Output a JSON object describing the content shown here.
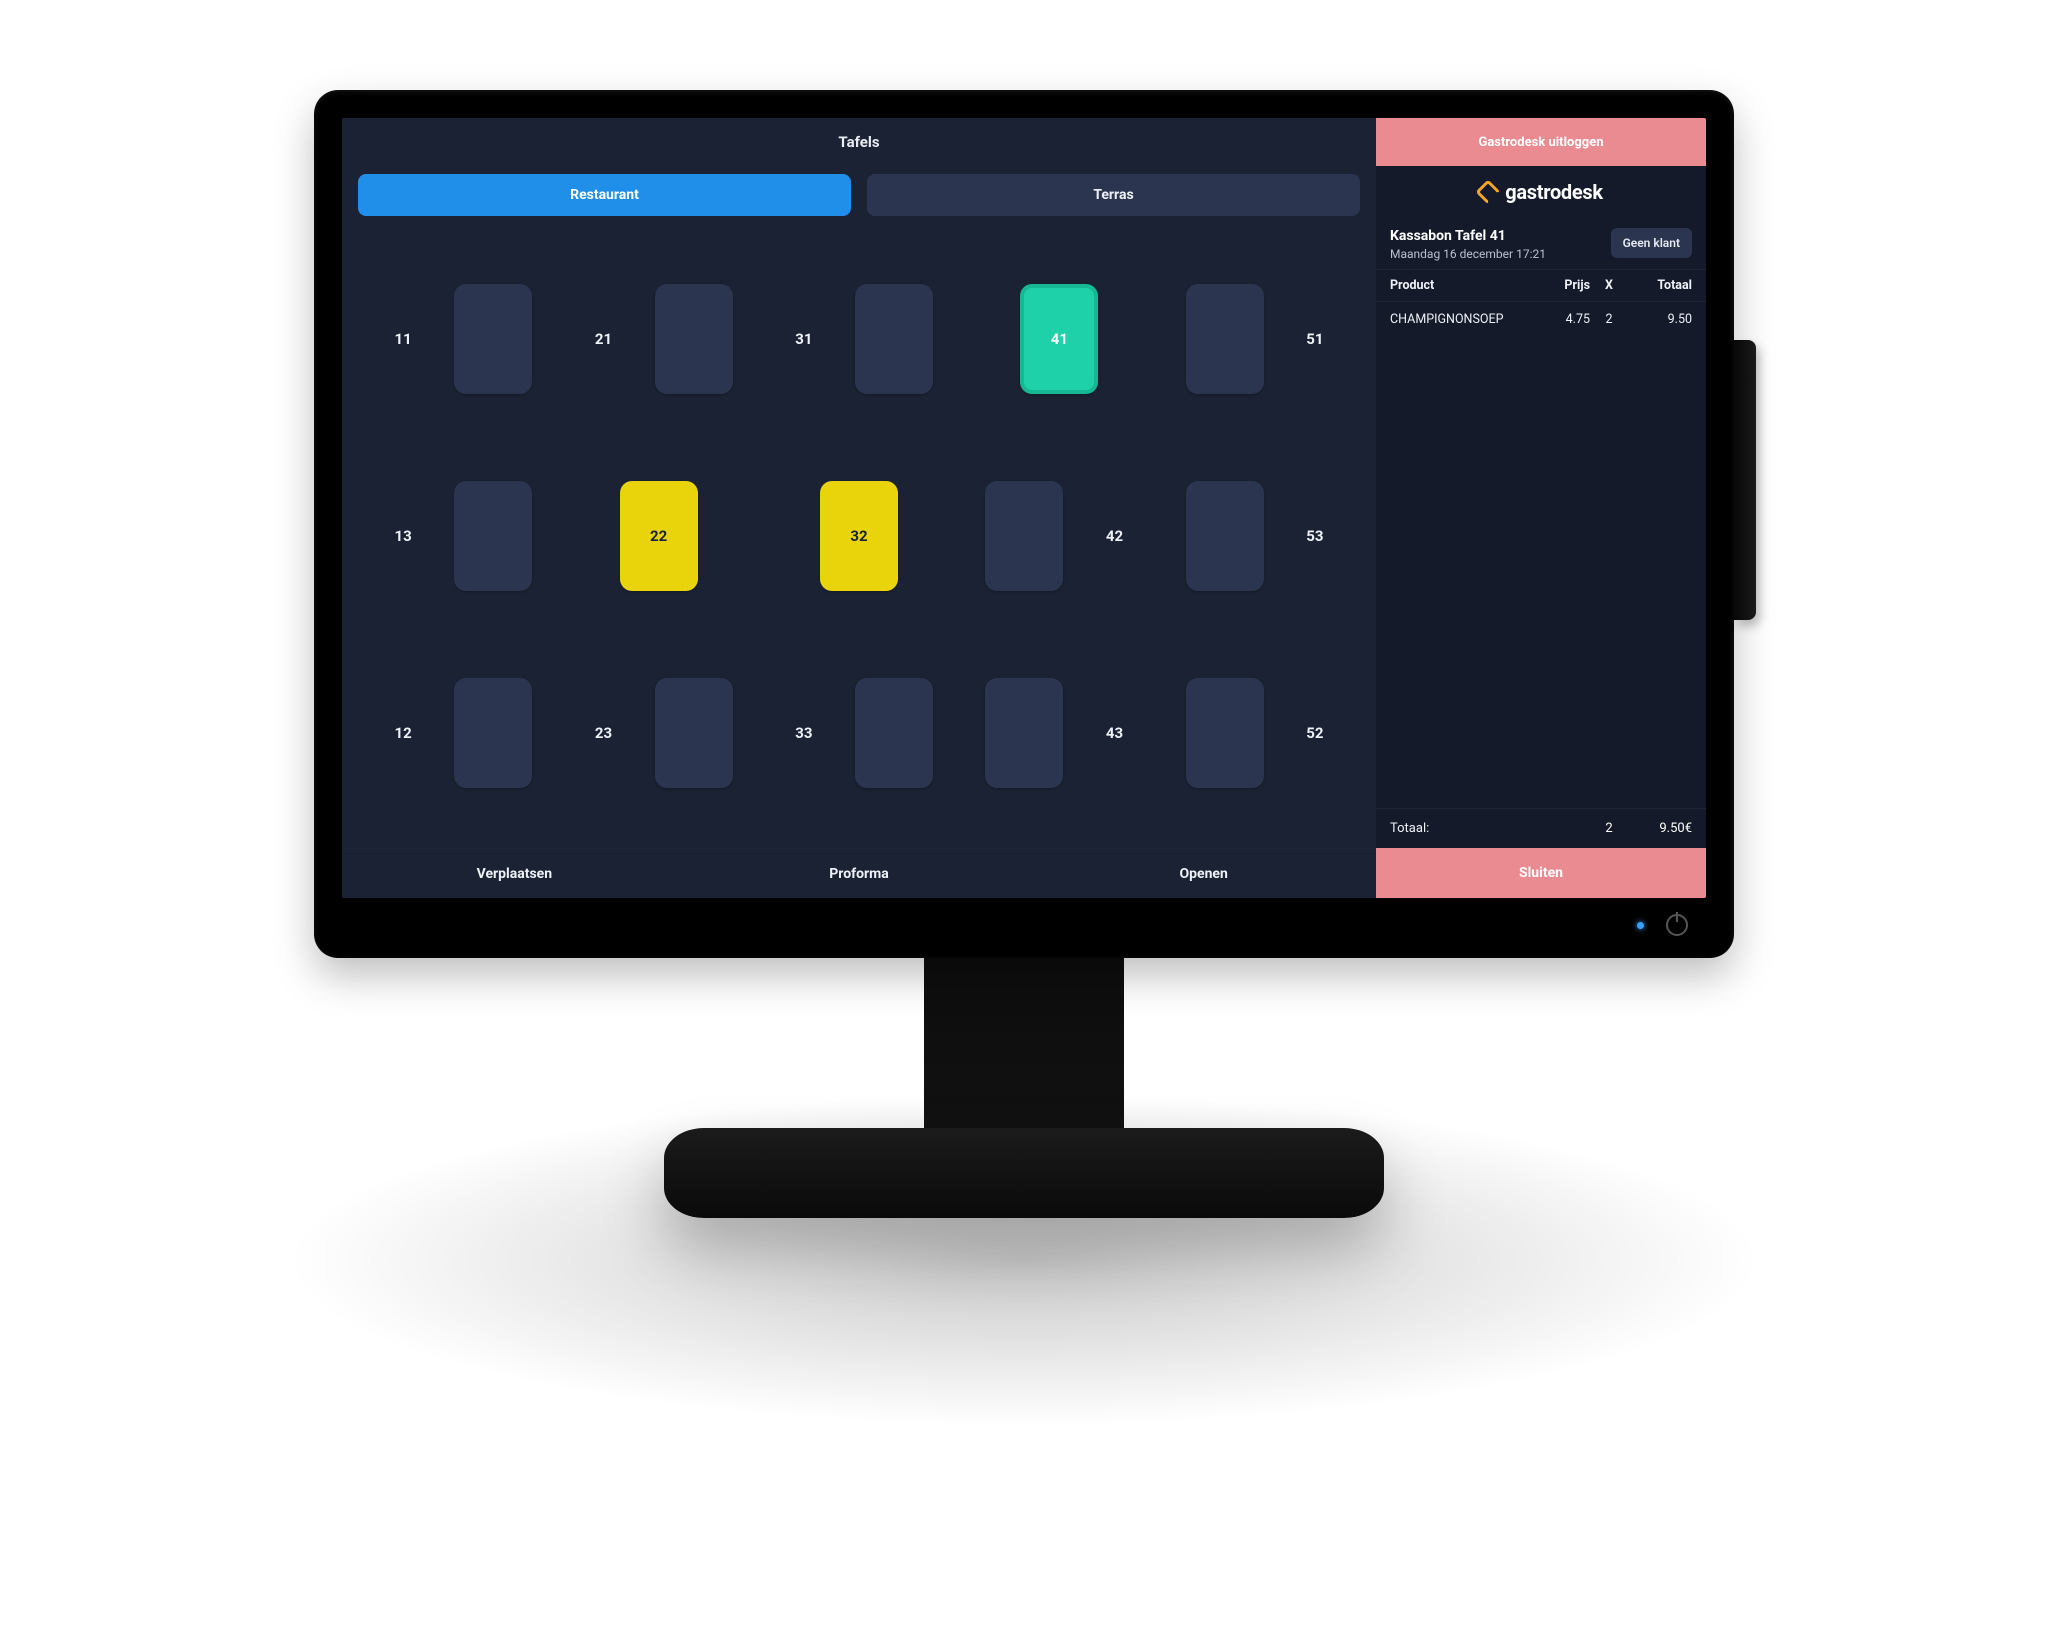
{
  "header": {
    "title": "Tafels"
  },
  "areas": {
    "tabs": [
      {
        "label": "Restaurant",
        "active": true
      },
      {
        "label": "Terras",
        "active": false
      }
    ]
  },
  "tables": [
    {
      "num": "11",
      "state": "normal",
      "label_side": "left"
    },
    {
      "num": "21",
      "state": "normal",
      "label_side": "left"
    },
    {
      "num": "31",
      "state": "normal",
      "label_side": "left"
    },
    {
      "num": "41",
      "state": "selected",
      "label_side": "inside"
    },
    {
      "num": "51",
      "state": "normal",
      "label_side": "right"
    },
    {
      "num": "13",
      "state": "normal",
      "label_side": "left"
    },
    {
      "num": "22",
      "state": "warn",
      "label_side": "inside"
    },
    {
      "num": "32",
      "state": "warn",
      "label_side": "inside"
    },
    {
      "num": "42",
      "state": "normal",
      "label_side": "right"
    },
    {
      "num": "53",
      "state": "normal",
      "label_side": "right"
    },
    {
      "num": "12",
      "state": "normal",
      "label_side": "left"
    },
    {
      "num": "23",
      "state": "normal",
      "label_side": "left"
    },
    {
      "num": "33",
      "state": "normal",
      "label_side": "left"
    },
    {
      "num": "43",
      "state": "normal",
      "label_side": "right"
    },
    {
      "num": "52",
      "state": "normal",
      "label_side": "right"
    }
  ],
  "bottom_actions": {
    "move": "Verplaatsen",
    "proforma": "Proforma",
    "open": "Openen"
  },
  "side": {
    "logout_label": "Gastrodesk uitloggen",
    "brand": "gastrodesk",
    "close_label": "Sluiten"
  },
  "receipt": {
    "title": "Kassabon Tafel 41",
    "date": "Maandag 16 december 17:21",
    "no_customer_label": "Geen klant",
    "cols": {
      "product": "Product",
      "price": "Prijs",
      "qty": "X",
      "total": "Totaal"
    },
    "rows": [
      {
        "name": "CHAMPIGNONSOEP",
        "price": "4.75",
        "qty": "2",
        "total": "9.50"
      }
    ],
    "totals": {
      "label": "Totaal:",
      "qty": "2",
      "amount": "9.50€"
    }
  }
}
